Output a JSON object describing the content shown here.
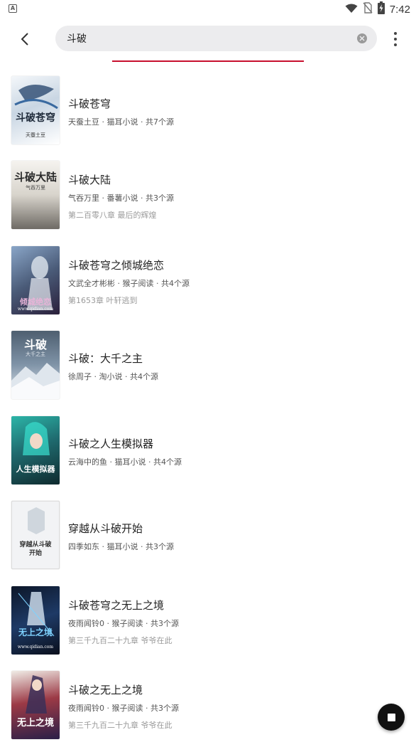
{
  "status_bar": {
    "time": "7:42",
    "left_icon": "A",
    "icons": [
      "wifi-icon",
      "no-sim-icon",
      "battery-charging-icon"
    ]
  },
  "toolbar": {
    "back_icon": "chevron-left-icon",
    "search_value": "斗破",
    "search_placeholder": "",
    "clear_icon": "clear-icon",
    "more_icon": "more-vert-icon"
  },
  "colors": {
    "accent": "#c8102e",
    "search_bg": "#ececee",
    "title": "#222222",
    "meta": "#555555",
    "latest": "#9a9a9a"
  },
  "books": [
    {
      "title": "斗破苍穹",
      "author": "天蚕土豆",
      "source": "猫耳小说",
      "count": "共7个源",
      "latest": ""
    },
    {
      "title": "斗破大陆",
      "author": "气吞万里",
      "source": "番薯小说",
      "count": "共3个源",
      "latest": "第二百零八章 最后的辉煌"
    },
    {
      "title": "斗破苍穹之倾城绝恋",
      "author": "文武全才彬彬",
      "source": "猴子阅读",
      "count": "共4个源",
      "latest": "第1653章 叶轩逃到"
    },
    {
      "title": "斗破：大千之主",
      "author": "徐周子",
      "source": "淘小说",
      "count": "共4个源",
      "latest": ""
    },
    {
      "title": "斗破之人生模拟器",
      "author": "云海中的鱼",
      "source": "猫耳小说",
      "count": "共4个源",
      "latest": ""
    },
    {
      "title": "穿越从斗破开始",
      "author": "四季如东",
      "source": "猫耳小说",
      "count": "共3个源",
      "latest": ""
    },
    {
      "title": "斗破苍穹之无上之境",
      "author": "夜雨闻铃0",
      "source": "猴子阅读",
      "count": "共3个源",
      "latest": "第三千九百二十九章 爷爷在此"
    },
    {
      "title": "斗破之无上之境",
      "author": "夜雨闻铃0",
      "source": "猴子阅读",
      "count": "共3个源",
      "latest": "第三千九百二十九章 爷爷在此"
    }
  ],
  "covers": [
    {
      "text": "斗破苍穹",
      "sub": "天蚕土豆",
      "bg": "#e8edf2",
      "fg": "#1e2a3a"
    },
    {
      "text": "斗破大陆",
      "sub": "气吞万里",
      "bg": "#d9d6cf",
      "fg": "#2a2a2a"
    },
    {
      "text": "倾城绝恋",
      "sub": "www.qidian.com",
      "bg": "#4a5b78",
      "fg": "#e8b4d8"
    },
    {
      "text": "斗破",
      "sub": "大千之主",
      "bg": "#5d6f80",
      "fg": "#ffffff"
    },
    {
      "text": "人生模拟器",
      "sub": "",
      "bg": "#1f6b6f",
      "fg": "#ffffff"
    },
    {
      "text": "穿越从斗破开始",
      "sub": "",
      "bg": "#f2f3f5",
      "fg": "#333333"
    },
    {
      "text": "无上之境",
      "sub": "www.qidian.com",
      "bg": "#13243f",
      "fg": "#7fd3ff"
    },
    {
      "text": "无上之境",
      "sub": "",
      "bg": "#3b2f58",
      "fg": "#ffffff"
    }
  ],
  "fab_icon": "stop-icon"
}
